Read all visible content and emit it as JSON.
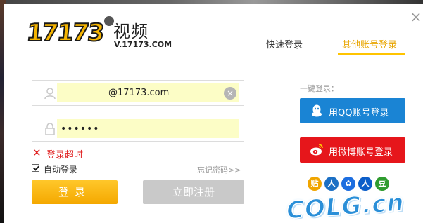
{
  "logo": {
    "digits": "17173",
    "video_label": "视频",
    "domain": "V.17173.COM"
  },
  "tabs": {
    "quick_login": "快速登录",
    "other_login": "其他账号登录"
  },
  "window": {
    "close_glyph": "×"
  },
  "form": {
    "username_value": "@17173.com",
    "password_value": "••••••",
    "clear_glyph": "×",
    "error_glyph": "✕",
    "error_text": "登录超时",
    "remember_label": "自动登录",
    "remember_checked": true,
    "forgot_link": "忘记密码>>",
    "login_button": "登录",
    "register_button": "立即注册"
  },
  "social": {
    "onekey_label": "一键登录：",
    "qq_button": "用QQ账号登录",
    "weibo_button": "用微博账号登录",
    "mini_icons": [
      {
        "icon": "tieba-icon",
        "glyph": "贴"
      },
      {
        "icon": "renren-icon",
        "glyph": "人"
      },
      {
        "icon": "baidu-icon",
        "glyph": "✿"
      },
      {
        "icon": "renren-user-icon",
        "glyph": "人"
      },
      {
        "icon": "douban-icon",
        "glyph": "豆"
      }
    ]
  },
  "watermark": "COLG.cn",
  "colors": {
    "accent": "#ffc400",
    "login_button": "#f4a800",
    "qq": "#1a84d4",
    "weibo": "#e6161b",
    "error": "#e02020"
  }
}
